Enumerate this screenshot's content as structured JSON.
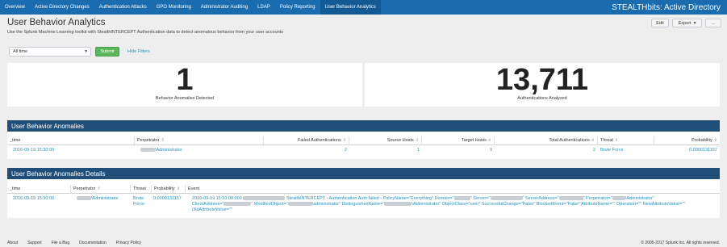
{
  "nav": {
    "tabs": [
      "Overview",
      "Active Directory Changes",
      "Authentication Attacks",
      "GPO Monitoring",
      "Administrator Auditing",
      "LDAP",
      "Policy Reporting",
      "User Behavior Analytics"
    ],
    "active_tab": "User Behavior Analytics",
    "brand": "STEALTHbits: Active Directory"
  },
  "page": {
    "title": "User Behavior Analytics",
    "description": "Use the Splunk Machine Learning toolkit with StealthINTERCEPT Authentication data to detect anomalous behavior from your user accounts"
  },
  "actions": {
    "edit": "Edit",
    "export": "Export",
    "more": "..."
  },
  "filters": {
    "time_value": "All time",
    "submit": "Submit",
    "hide_filters": "Hide Filters"
  },
  "single_values": [
    {
      "value": "1",
      "label": "Behavior Anomalies Detected"
    },
    {
      "value": "13,711",
      "label": "Authentications Analyzed"
    }
  ],
  "anomalies": {
    "title": "User Behavior Anomalies",
    "columns": [
      "_time",
      "Perpetrator",
      "Failed Authentications",
      "Source Hosts",
      "Target Hosts",
      "Total Authentications",
      "Threat",
      "Probability"
    ],
    "rows": [
      {
        "time": "2016-09-19 15:30:00",
        "perpetrator": "\\Administrator",
        "failed": "2",
        "source_hosts": "1",
        "target_hosts": "0",
        "total": "2",
        "threat": "Brute Force",
        "probability": "0.0000131157"
      }
    ]
  },
  "details": {
    "title": "User Behavior Anomalies Details",
    "columns": [
      "_time",
      "Perpetrator",
      "Threat",
      "Probability",
      "Event"
    ],
    "rows": [
      {
        "time": "2016-09-19 15:30:00",
        "perpetrator": "\\Administrator",
        "threat_line1": "Brute",
        "threat_line2": "Force",
        "probability": "0.0000131157",
        "event_line1_a": "2016-09-19 15:33:00.000",
        "event_line1_b": "StealthINTERCEPT - Authentication Auth failed - PolicyName=\"Everything\" Domain=\"",
        "event_line1_c": "\" Server=\"",
        "event_line1_d": "\" ServerAddress=\"",
        "event_line1_e": "\" Perpetrator=\"",
        "event_line1_f": "\\Administrator\"",
        "event_line2_a": "ClientAddress=\"",
        "event_line2_b": "\" ModifiedObject=\"",
        "event_line2_c": "\\administrator\" DistinguishedName=\"",
        "event_line2_d": "\\Administrator\" ObjectClass=\"user\" SuccessfulChange=\"False\" BlockedEvent=\"False\" AttributeName=\"\" Operation=\"\" NewAttributeValue=\"\"",
        "event_line3": "OldAttributeValue=\"\""
      }
    ]
  },
  "footer": {
    "links": [
      "About",
      "Support",
      "File a Bug",
      "Documentation",
      "Privacy Policy"
    ],
    "copyright": "© 2005-2017 Splunk Inc. All rights reserved."
  },
  "colors": {
    "nav_bg": "#1a6cae",
    "panel_header": "#1f4e79",
    "link": "#1e93c6",
    "submit": "#5cb85c"
  }
}
